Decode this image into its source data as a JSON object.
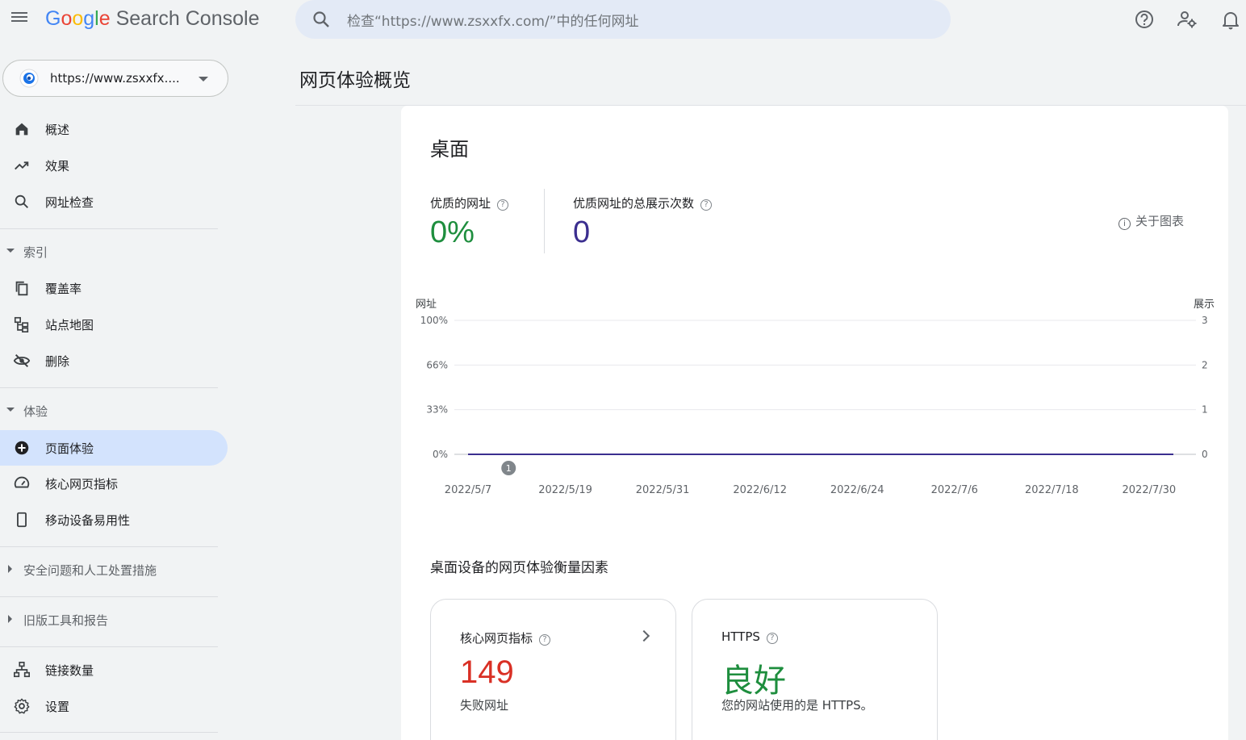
{
  "app": {
    "logo_google": "Google",
    "logo_product": "Search Console",
    "logo_colors": [
      "#4285f4",
      "#ea4335",
      "#fbbc05",
      "#4285f4",
      "#34a853",
      "#ea4335"
    ]
  },
  "search": {
    "placeholder": "检查“https://www.zsxxfx.com/”中的任何网址"
  },
  "topbar": {
    "icons": [
      "help-icon",
      "account-settings-icon",
      "notifications-icon"
    ]
  },
  "property": {
    "label": "https://www.zsxxfx...."
  },
  "sidebar": {
    "top_items": [
      {
        "label": "概述",
        "icon": "home-icon"
      },
      {
        "label": "效果",
        "icon": "trending-up-icon"
      },
      {
        "label": "网址检查",
        "icon": "search-icon"
      }
    ],
    "index_section": {
      "title": "索引",
      "items": [
        {
          "label": "覆盖率",
          "icon": "copy-icon"
        },
        {
          "label": "站点地图",
          "icon": "sitemap-icon"
        },
        {
          "label": "删除",
          "icon": "visibility-off-icon"
        }
      ]
    },
    "experience_section": {
      "title": "体验",
      "items": [
        {
          "label": "页面体验",
          "icon": "add-circle-icon"
        },
        {
          "label": "核心网页指标",
          "icon": "speed-icon"
        },
        {
          "label": "移动设备易用性",
          "icon": "smartphone-icon"
        }
      ]
    },
    "security_section": {
      "title": "安全问题和人工处置措施"
    },
    "legacy_section": {
      "title": "旧版工具和报告"
    },
    "bottom_items": [
      {
        "label": "链接数量",
        "icon": "links-icon"
      },
      {
        "label": "设置",
        "icon": "settings-icon"
      }
    ]
  },
  "page": {
    "title": "网页体验概览"
  },
  "card": {
    "title": "桌面",
    "metrics": [
      {
        "label": "优质的网址",
        "value": "0%",
        "color": "#1e8e3e"
      },
      {
        "label": "优质网址的总展示次数",
        "value": "0",
        "color": "#3b2e8f"
      }
    ],
    "about_chart": "关于图表"
  },
  "chart_data": {
    "type": "line",
    "left_axis_title": "网址",
    "right_axis_title": "展示",
    "left_ticks": [
      "100%",
      "66%",
      "33%",
      "0%"
    ],
    "right_ticks": [
      "3",
      "2",
      "1",
      "0"
    ],
    "x_tick_labels": [
      "2022/5/7",
      "2022/5/19",
      "2022/5/31",
      "2022/6/12",
      "2022/6/24",
      "2022/7/6",
      "2022/7/18",
      "2022/7/30"
    ],
    "ylim_left": [
      0,
      100
    ],
    "ylim_right": [
      0,
      3
    ],
    "grid": true,
    "x_start": "2022/5/7",
    "x_end": "2022/8/2",
    "series": [
      {
        "values": [
          0,
          0
        ],
        "color": "#3b2e8f"
      }
    ],
    "annotations": [
      {
        "x": "2022/5/12",
        "label": "1"
      }
    ]
  },
  "factors": {
    "title": "桌面设备的网页体验衡量因素",
    "cards": [
      {
        "title": "核心网页指标",
        "value": "149",
        "sub": "失败网址",
        "value_color": "#d93025"
      },
      {
        "title": "HTTPS",
        "value": "良好",
        "sub": "您的网站使用的是 HTTPS。",
        "value_color": "#1e8e3e"
      }
    ]
  }
}
